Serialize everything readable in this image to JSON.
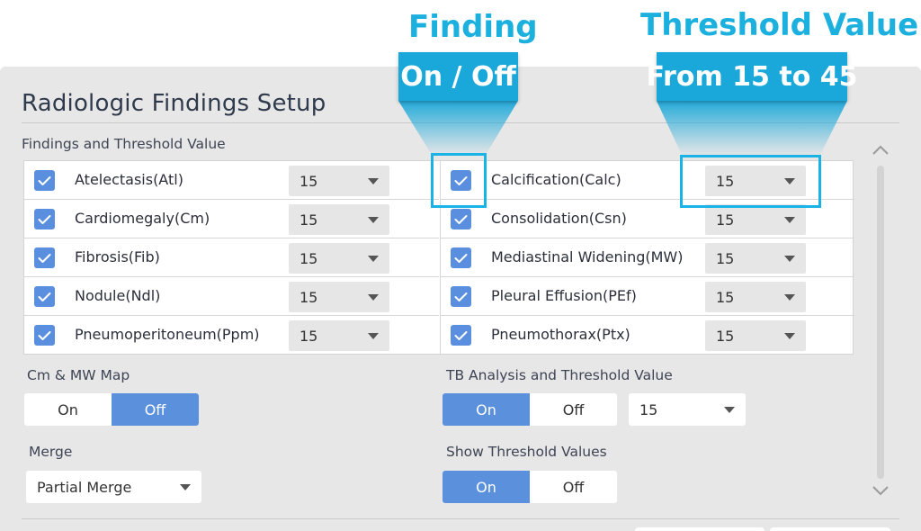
{
  "callouts": {
    "finding": {
      "title": "Finding",
      "badge": "On / Off"
    },
    "threshold": {
      "title": "Threshold Value",
      "badge": "From 15 to 45"
    }
  },
  "panel": {
    "title": "Radiologic Findings Setup",
    "findings_section_label": "Findings and Threshold Value"
  },
  "findings": {
    "left": [
      {
        "label": "Atelectasis(Atl)",
        "checked": true,
        "value": "15"
      },
      {
        "label": "Cardiomegaly(Cm)",
        "checked": true,
        "value": "15"
      },
      {
        "label": "Fibrosis(Fib)",
        "checked": true,
        "value": "15"
      },
      {
        "label": "Nodule(Ndl)",
        "checked": true,
        "value": "15"
      },
      {
        "label": "Pneumoperitoneum(Ppm)",
        "checked": true,
        "value": "15"
      }
    ],
    "right": [
      {
        "label": "Calcification(Calc)",
        "checked": true,
        "value": "15"
      },
      {
        "label": "Consolidation(Csn)",
        "checked": true,
        "value": "15"
      },
      {
        "label": "Mediastinal Widening(MW)",
        "checked": true,
        "value": "15"
      },
      {
        "label": "Pleural Effusion(PEf)",
        "checked": true,
        "value": "15"
      },
      {
        "label": "Pneumothorax(Ptx)",
        "checked": true,
        "value": "15"
      }
    ]
  },
  "cm_mw_map": {
    "label": "Cm & MW Map",
    "on": "On",
    "off": "Off",
    "selected": "Off"
  },
  "merge": {
    "label": "Merge",
    "value": "Partial Merge"
  },
  "tb": {
    "label": "TB Analysis and Threshold Value",
    "on": "On",
    "off": "Off",
    "selected": "On",
    "threshold": "15"
  },
  "show_threshold": {
    "label": "Show Threshold Values",
    "on": "On",
    "off": "Off",
    "selected": "On"
  },
  "colors": {
    "accent": "#5b90dd",
    "callout": "#1aa7d9",
    "highlight": "#19b3e6",
    "panel": "#e7e7e7"
  },
  "icons": {
    "checkbox": "check-icon",
    "dropdown": "chevron-down-icon",
    "scroll_up": "chevron-up-icon",
    "scroll_down": "chevron-down-icon"
  }
}
